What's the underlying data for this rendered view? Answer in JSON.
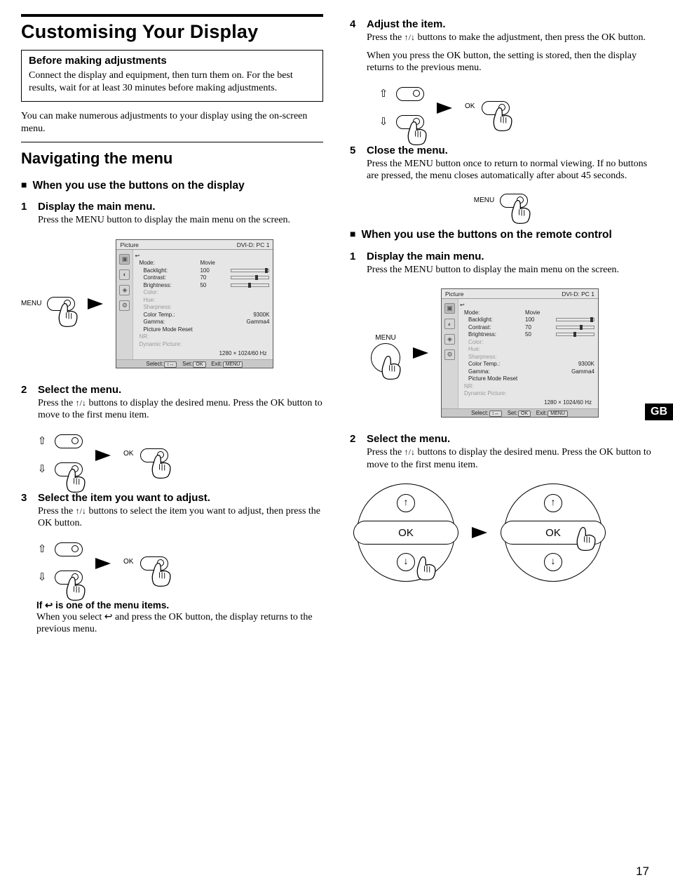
{
  "page_number": "17",
  "lang_tag": "GB",
  "left": {
    "title": "Customising Your Display",
    "box_head": "Before making adjustments",
    "box_text": "Connect the display and equipment, then turn them on. For the best results, wait for at least 30 minutes before making adjustments.",
    "intro": "You can make numerous adjustments to your display using the on-screen menu.",
    "h2": "Navigating the menu",
    "sq1": "When you use the buttons on the display",
    "s1_title": "Display the main menu.",
    "s1_text": "Press the MENU button to display the main menu on the screen.",
    "s2_title": "Select the menu.",
    "s2_text_a": "Press the ",
    "s2_text_b": " buttons to display the desired menu. Press the OK button to move to the first menu item.",
    "s3_title": "Select the item you want to adjust.",
    "s3_text_a": "Press the ",
    "s3_text_b": " buttons to select the item you want to adjust, then press the OK button.",
    "note_head_a": "If ",
    "note_head_b": " is one of the menu items.",
    "note_text_a": "When you select ",
    "note_text_b": " and press the OK button, the display returns to the previous menu."
  },
  "right": {
    "s4_title": "Adjust the item.",
    "s4_text_a": "Press the ",
    "s4_text_b": " buttons to make the adjustment, then press the OK button.",
    "s4_text2": "When you press the OK button, the setting is stored, then the display returns to the previous menu.",
    "s5_title": "Close the menu.",
    "s5_text": "Press the MENU button once to return to normal viewing. If no buttons are pressed, the menu closes automatically after about 45 seconds.",
    "sq2": "When you use the buttons on the remote control",
    "r1_title": "Display the main menu.",
    "r1_text": "Press the MENU button to display the main menu on the screen.",
    "r2_title": "Select the menu.",
    "r2_text_a": "Press the ",
    "r2_text_b": " buttons to display the desired menu. Press the OK button to move to the first menu item."
  },
  "labels": {
    "menu": "MENU",
    "ok": "OK"
  },
  "osd": {
    "title": "Picture",
    "source": "DVI-D: PC 1",
    "rows": {
      "mode_l": "Mode:",
      "mode_v": "Movie",
      "back_l": "Backlight:",
      "back_v": "100",
      "cont_l": "Contrast:",
      "cont_v": "70",
      "brig_l": "Brightness:",
      "brig_v": "50",
      "color_l": "Color:",
      "hue_l": "Hue:",
      "sharp_l": "Sharpness:",
      "temp_l": "Color  Temp.:",
      "temp_v": "9300K",
      "gamma_l": "Gamma:",
      "gamma_v": "Gamma4",
      "reset_l": "Picture Mode Reset",
      "nr_l": "NR:",
      "dyn_l": "Dynamic Picture:"
    },
    "res": "1280 × 1024/60 Hz",
    "foot_select": "Select:",
    "foot_set": "Set:",
    "foot_exit": "Exit:"
  }
}
